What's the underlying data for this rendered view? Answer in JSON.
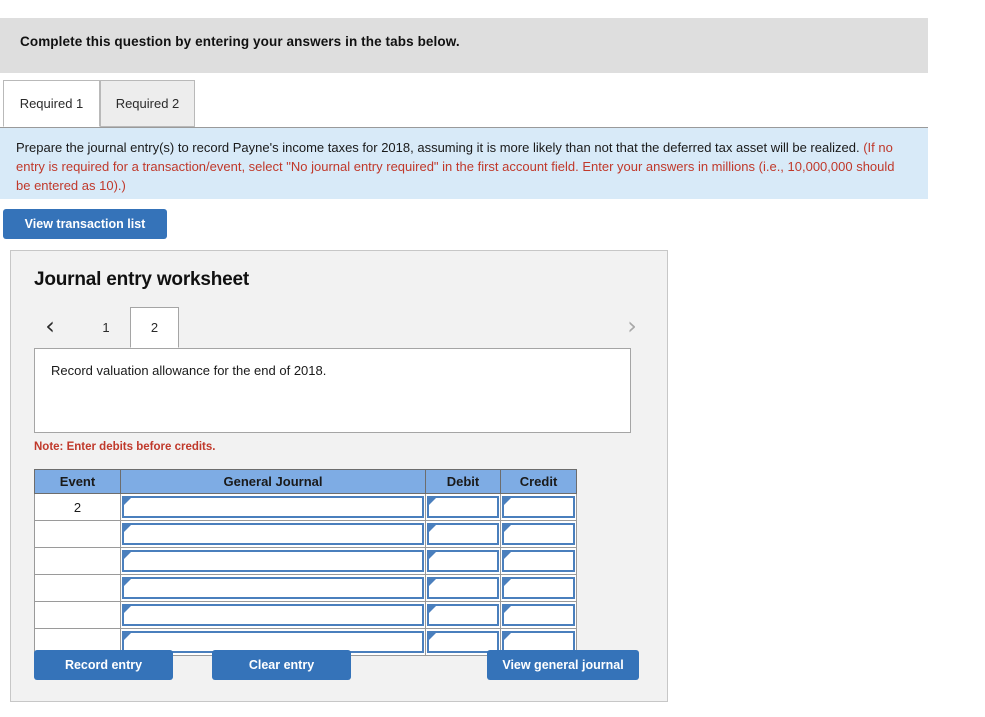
{
  "banner": {
    "text": "Complete this question by entering your answers in the tabs below."
  },
  "required_tabs": [
    {
      "label": "Required 1",
      "active": true
    },
    {
      "label": "Required 2",
      "active": false
    }
  ],
  "instructions": {
    "black_part": "Prepare the journal entry(s) to record Payne's income taxes for 2018, assuming it is more likely than not that the deferred tax asset will be realized.",
    "red_part": "(If no entry is required for a transaction/event, select \"No journal entry required\" in the first account field. Enter your answers in millions (i.e., 10,000,000 should be entered as 10).)"
  },
  "toolbar": {
    "view_transaction_list_label": "View transaction list"
  },
  "worksheet": {
    "title": "Journal entry worksheet",
    "pager": {
      "prev_icon": "‹",
      "next_icon": "›",
      "tabs": [
        {
          "label": "1",
          "active": false
        },
        {
          "label": "2",
          "active": true
        }
      ]
    },
    "description": "Record valuation allowance for the end of 2018.",
    "note": "Note: Enter debits before credits.",
    "table": {
      "columns": [
        "Event",
        "General Journal",
        "Debit",
        "Credit"
      ],
      "rows": [
        {
          "event": "2",
          "journal": "",
          "debit": "",
          "credit": ""
        },
        {
          "event": "",
          "journal": "",
          "debit": "",
          "credit": ""
        },
        {
          "event": "",
          "journal": "",
          "debit": "",
          "credit": ""
        },
        {
          "event": "",
          "journal": "",
          "debit": "",
          "credit": ""
        },
        {
          "event": "",
          "journal": "",
          "debit": "",
          "credit": ""
        },
        {
          "event": "",
          "journal": "",
          "debit": "",
          "credit": ""
        }
      ]
    },
    "buttons": {
      "record_entry": "Record entry",
      "clear_entry": "Clear entry",
      "view_general_journal": "View general journal"
    }
  },
  "colors": {
    "accent_blue": "#3573b9",
    "table_header_blue": "#7eace4",
    "field_border_blue": "#4a7fbd",
    "instruction_bg": "#d8eaf8",
    "banner_bg": "#dedede",
    "note_red": "#c0392b"
  }
}
